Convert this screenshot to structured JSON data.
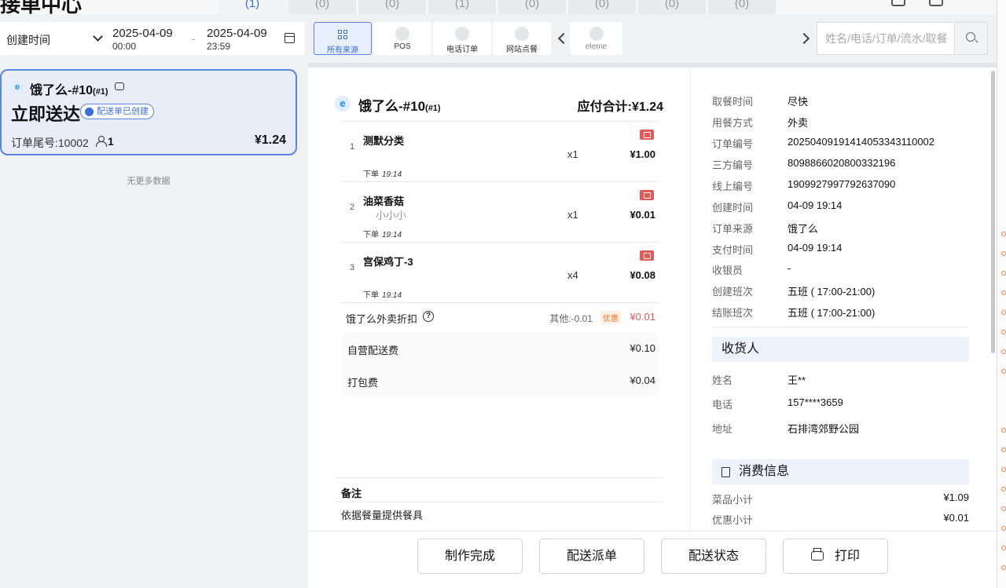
{
  "app": {
    "title": "接单中心"
  },
  "top_tabs": [
    "(1)",
    "(0)",
    "(0)",
    "(1)",
    "(0)",
    "(0)",
    "(0)",
    "(0)"
  ],
  "filter": {
    "date_type": "创建时间",
    "start_date": "2025-04-09",
    "start_time": "00:00",
    "separator": "-",
    "end_date": "2025-04-09",
    "end_time": "23:59",
    "sources": [
      {
        "label": "所有来源",
        "icon": "grid-icon"
      },
      {
        "label": "POS",
        "icon": "pos-icon"
      },
      {
        "label": "电话订单",
        "icon": "phone-icon"
      },
      {
        "label": "网站点餐",
        "icon": "web-icon"
      },
      {
        "label": "eleme",
        "icon": "eleme-icon"
      }
    ],
    "search_placeholder": "姓名/电话/订单/流水/取餐"
  },
  "order_list": {
    "cards": [
      {
        "title": "饿了么-#10",
        "title_suffix": "(#1)",
        "delivery": "立即送达",
        "badge": "配送单已创建",
        "tail_label": "订单尾号:10002",
        "people": "1",
        "price": "¥1.24"
      }
    ],
    "end_text": "无更多数据"
  },
  "order_detail": {
    "title": "饿了么-#10",
    "title_suffix": "(#1)",
    "total_label": "应付合计:¥1.24",
    "items": [
      {
        "no": "1",
        "name": "测默分类",
        "note": "",
        "qty": "x1",
        "price": "¥1.00",
        "time_label": "下单",
        "time": "19:14"
      },
      {
        "no": "2",
        "name": "油菜香菇",
        "note": "小小小",
        "qty": "x1",
        "price": "¥0.01",
        "time_label": "下单",
        "time": "19:14"
      },
      {
        "no": "3",
        "name": "宫保鸡丁-3",
        "note": "",
        "qty": "x4",
        "price": "¥0.08",
        "time_label": "下单",
        "time": "19:14"
      }
    ],
    "discount": {
      "label": "饿了么外卖折扣",
      "other": "其他:-0.01",
      "tag": "优惠",
      "value": "¥0.01"
    },
    "fees": [
      {
        "label": "自营配送费",
        "value": "¥0.10"
      },
      {
        "label": "打包费",
        "value": "¥0.04"
      }
    ],
    "remark": {
      "title": "备注",
      "text": "依据餐量提供餐具"
    }
  },
  "order_info": {
    "rows": [
      {
        "k": "取餐时间",
        "v": "尽快"
      },
      {
        "k": "用餐方式",
        "v": "外卖"
      },
      {
        "k": "订单编号",
        "v": "20250409191414053343110002"
      },
      {
        "k": "三方编号",
        "v": "8098866020800332196"
      },
      {
        "k": "线上编号",
        "v": "1909927997792637090"
      },
      {
        "k": "创建时间",
        "v": "04-09 19:14"
      },
      {
        "k": "订单来源",
        "v": "饿了么"
      },
      {
        "k": "支付时间",
        "v": "04-09 19:14"
      },
      {
        "k": "收银员",
        "v": "-"
      },
      {
        "k": "创建班次",
        "v": "五班 ( 17:00-21:00)"
      },
      {
        "k": "结账班次",
        "v": "五班 ( 17:00-21:00)"
      }
    ],
    "receiver_title": "收货人",
    "receiver": [
      {
        "k": "姓名",
        "v": "王**"
      },
      {
        "k": "电话",
        "v": "157****3659"
      },
      {
        "k": "地址",
        "v": "石排湾郊野公园"
      }
    ],
    "consume_title": "消费信息",
    "consume": [
      {
        "k": "菜品小计",
        "v": "¥1.09"
      },
      {
        "k": "优惠小计",
        "v": "¥0.01"
      }
    ]
  },
  "actions": {
    "finish": "制作完成",
    "dispatch": "配送派单",
    "status": "配送状态",
    "print": "打印"
  },
  "colors": {
    "accent": "#3a6fd8",
    "danger": "#e25a57",
    "card_bg": "#e8edf8"
  }
}
